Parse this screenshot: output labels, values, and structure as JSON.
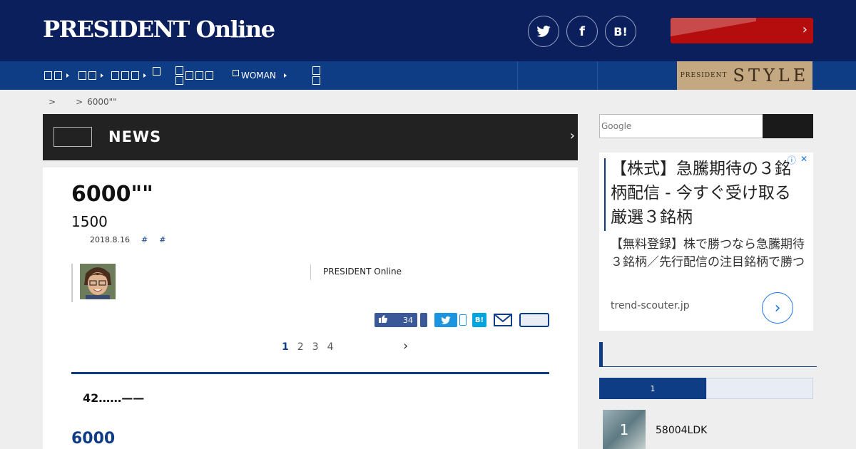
{
  "header": {
    "logo": "PRESIDENT Online",
    "sns": {
      "twitter": "𝕥",
      "facebook": "f",
      "hatena": "B!"
    }
  },
  "nav": {
    "items": [
      {
        "label": "",
        "has_arrow": true
      },
      {
        "label": "",
        "has_arrow": true
      },
      {
        "label": "",
        "has_arrow": true
      },
      {
        "label": ""
      },
      {
        "label": ""
      },
      {
        "label": "WOMAN",
        "has_arrow": true
      },
      {
        "label": ""
      }
    ],
    "style_banner": {
      "small": "PRESIDENT",
      "big": "STYLE"
    }
  },
  "breadcrumb": [
    "",
    ">",
    "",
    ">",
    "6000\"\""
  ],
  "category": {
    "name": "NEWS"
  },
  "article": {
    "title": "6000\"\"",
    "subtitle": "1500",
    "date": "2018.8.16",
    "tags": [
      "#",
      "#"
    ],
    "publisher": "PRESIDENT Online",
    "share": {
      "like_count": "34",
      "hatena": "B!"
    },
    "pages": [
      "1",
      "2",
      "3",
      "4"
    ],
    "current_page": "1",
    "lead": "42……——",
    "heading": "6000"
  },
  "sidebar": {
    "search_placeholder": "Google",
    "ad": {
      "headline": "【株式】急騰期待の３銘柄配信 - 今すぐ受け取る厳選３銘柄",
      "body": "【無料登録】株で勝つなら急騰期待３銘柄／先行配信の注目銘柄で勝つ",
      "source": "trend-scouter.jp"
    },
    "ranking": {
      "tabs": [
        "1",
        ""
      ],
      "items": [
        {
          "rank": "1",
          "title": "58004LDK"
        }
      ]
    }
  },
  "colors": {
    "navy": "#0b1f5c",
    "nav_blue": "#0e3d86",
    "promo_red": "#b50d0d",
    "style_tan": "#c4a882"
  }
}
